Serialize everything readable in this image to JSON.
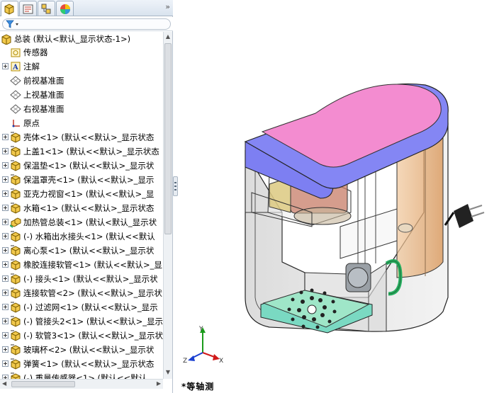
{
  "tabs": [
    {
      "name": "feature-manager",
      "icon": "feature-tree-icon"
    },
    {
      "name": "property-manager",
      "icon": "property-icon"
    },
    {
      "name": "configuration-manager",
      "icon": "configuration-icon"
    },
    {
      "name": "display-manager",
      "icon": "appearance-icon"
    }
  ],
  "expand_glyph": "»",
  "tree": {
    "root": "总装 (默认<默认_显示状态-1>)",
    "items": [
      {
        "label": "传感器",
        "icon": "sensor-icon",
        "expandable": false
      },
      {
        "label": "注解",
        "icon": "annotation-icon",
        "expandable": true
      },
      {
        "label": "前视基准面",
        "icon": "plane-icon",
        "expandable": false
      },
      {
        "label": "上视基准面",
        "icon": "plane-icon",
        "expandable": false
      },
      {
        "label": "右视基准面",
        "icon": "plane-icon",
        "expandable": false
      },
      {
        "label": "原点",
        "icon": "origin-icon",
        "expandable": false
      },
      {
        "label": "壳体<1> (默认<<默认>_显示状态",
        "icon": "part-icon",
        "expandable": true
      },
      {
        "label": "上盖1<1> (默认<<默认>_显示状态",
        "icon": "part-icon",
        "expandable": true
      },
      {
        "label": "保温垫<1> (默认<<默认>_显示状",
        "icon": "part-icon",
        "expandable": true
      },
      {
        "label": "保温罩壳<1> (默认<<默认>_显示",
        "icon": "part-icon",
        "expandable": true
      },
      {
        "label": "亚克力视窗<1> (默认<<默认>_显",
        "icon": "part-icon",
        "expandable": true
      },
      {
        "label": "水箱<1> (默认<<默认>_显示状态",
        "icon": "part-icon",
        "expandable": true
      },
      {
        "label": "加热管总装<1> (默认<默认_显示状",
        "icon": "assembly-icon",
        "expandable": true
      },
      {
        "label": "(-) 水箱出水接头<1> (默认<<默认",
        "icon": "part-icon",
        "expandable": true
      },
      {
        "label": "离心泵<1> (默认<<默认>_显示状",
        "icon": "part-icon",
        "expandable": true
      },
      {
        "label": "橡胶连接软管<1> (默认<<默认>_显",
        "icon": "part-icon",
        "expandable": true
      },
      {
        "label": "(-) 接头<1> (默认<<默认>_显示状",
        "icon": "part-icon",
        "expandable": true
      },
      {
        "label": "连接软管<2> (默认<<默认>_显示状",
        "icon": "part-icon",
        "expandable": true
      },
      {
        "label": "(-) 过滤网<1> (默认<<默认>_显示",
        "icon": "part-icon",
        "expandable": true
      },
      {
        "label": "(-) 管接头2<1> (默认<<默认>_显示",
        "icon": "part-icon",
        "expandable": true
      },
      {
        "label": "(-) 软管3<1> (默认<<默认>_显示状",
        "icon": "part-icon",
        "expandable": true
      },
      {
        "label": "玻璃杯<2> (默认<<默认>_显示状",
        "icon": "part-icon",
        "expandable": true
      },
      {
        "label": "弹簧<1> (默认<<默认>_显示状态",
        "icon": "part-icon",
        "expandable": true
      },
      {
        "label": "(-) 重量传感器<1> (默认<<默认",
        "icon": "part-icon",
        "expandable": true
      }
    ]
  },
  "viewport": {
    "view_name": "*等轴测",
    "triad": {
      "x": "X",
      "y": "Y",
      "z": "Z"
    }
  },
  "colors": {
    "lid_top": "#f38cd0",
    "lid_band": "#7d7ff2",
    "tray": "#9fe6c8",
    "housing": "#d8d8d8",
    "tank_amber": "#e8b07a"
  }
}
